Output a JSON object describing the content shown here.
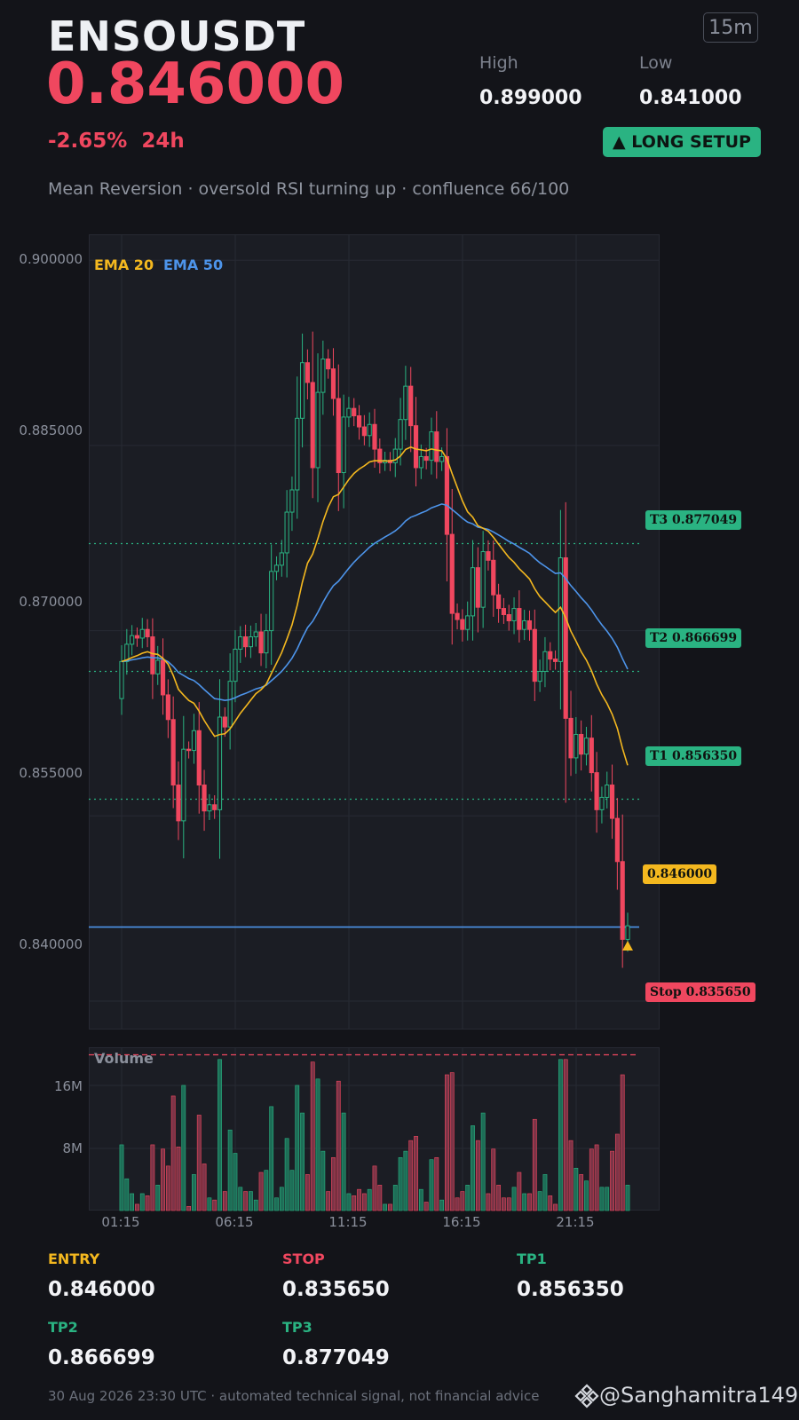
{
  "header": {
    "symbol": "ENSOUSDT",
    "price": "0.846000",
    "change": "-2.65%",
    "period": "24h",
    "timeframe": "15m",
    "high_label": "High",
    "high_value": "0.899000",
    "low_label": "Low",
    "low_value": "0.841000",
    "setup_badge": "▲ LONG SETUP",
    "subtitle": "Mean Reversion · oversold RSI turning up · confluence 66/100"
  },
  "colors": {
    "up": "#2ab382",
    "down": "#f0475f",
    "ema20": "#f4b81f",
    "ema50": "#4d94ea",
    "entry": "#f4b81f",
    "stop": "#f0475f",
    "target": "#2ab382"
  },
  "chart_data": {
    "type": "candlestick",
    "legend": [
      "EMA 20",
      "EMA 50"
    ],
    "ylim": [
      0.8377,
      0.9021
    ],
    "y_ticks": [
      "0.900000",
      "0.885000",
      "0.870000",
      "0.855000",
      "0.840000"
    ],
    "x_ticks": [
      "01:15",
      "06:15",
      "11:15",
      "16:15",
      "21:15"
    ],
    "close": [
      0.8675,
      0.8689,
      0.8696,
      0.8694,
      0.8701,
      0.8695,
      0.8665,
      0.8676,
      0.8648,
      0.8628,
      0.8575,
      0.8546,
      0.8604,
      0.8603,
      0.8619,
      0.8575,
      0.8554,
      0.8559,
      0.8555,
      0.863,
      0.8622,
      0.8659,
      0.8685,
      0.8695,
      0.8687,
      0.8695,
      0.8699,
      0.8682,
      0.87,
      0.8748,
      0.8753,
      0.8763,
      0.8796,
      0.8814,
      0.8872,
      0.8917,
      0.8901,
      0.8832,
      0.8893,
      0.892,
      0.8912,
      0.8888,
      0.8828,
      0.8873,
      0.888,
      0.8874,
      0.8865,
      0.8858,
      0.8867,
      0.8847,
      0.8836,
      0.8838,
      0.8836,
      0.8847,
      0.8871,
      0.8898,
      0.8866,
      0.8832,
      0.8841,
      0.8838,
      0.8861,
      0.8837,
      0.8841,
      0.8778,
      0.8714,
      0.8709,
      0.8701,
      0.8712,
      0.8751,
      0.8719,
      0.8764,
      0.8757,
      0.8729,
      0.8718,
      0.8713,
      0.8708,
      0.8718,
      0.8701,
      0.8708,
      0.8701,
      0.8659,
      0.8667,
      0.8683,
      0.8677,
      0.8675,
      0.8759,
      0.8629,
      0.8597,
      0.8616,
      0.86,
      0.8613,
      0.8585,
      0.8555,
      0.8565,
      0.8575,
      0.8548,
      0.8513,
      0.845,
      0.8461
    ],
    "volume_y_ticks": [
      "16M",
      "8M"
    ],
    "volume_ylim": [
      0,
      20
    ]
  },
  "levels": {
    "current_tag": "0.846000",
    "stop_tag": "Stop 0.835650",
    "t1_tag": "T1 0.856350",
    "t2_tag": "T2 0.866699",
    "t3_tag": "T3 0.877049",
    "entry_label": "ENTRY",
    "entry_value": "0.846000",
    "stop_label": "STOP",
    "stop_value": "0.835650",
    "tp1_label": "TP1",
    "tp1_value": "0.856350",
    "tp2_label": "TP2",
    "tp2_value": "0.866699",
    "tp3_label": "TP3",
    "tp3_value": "0.877049",
    "entry_price": 0.846,
    "stop_price": 0.83565,
    "t1_price": 0.85635,
    "t2_price": 0.866699,
    "t3_price": 0.877049
  },
  "footer": {
    "text": "30 Aug 2026 23:30 UTC  ·  automated technical signal, not financial advice",
    "watermark": "@Sanghamitra149"
  }
}
